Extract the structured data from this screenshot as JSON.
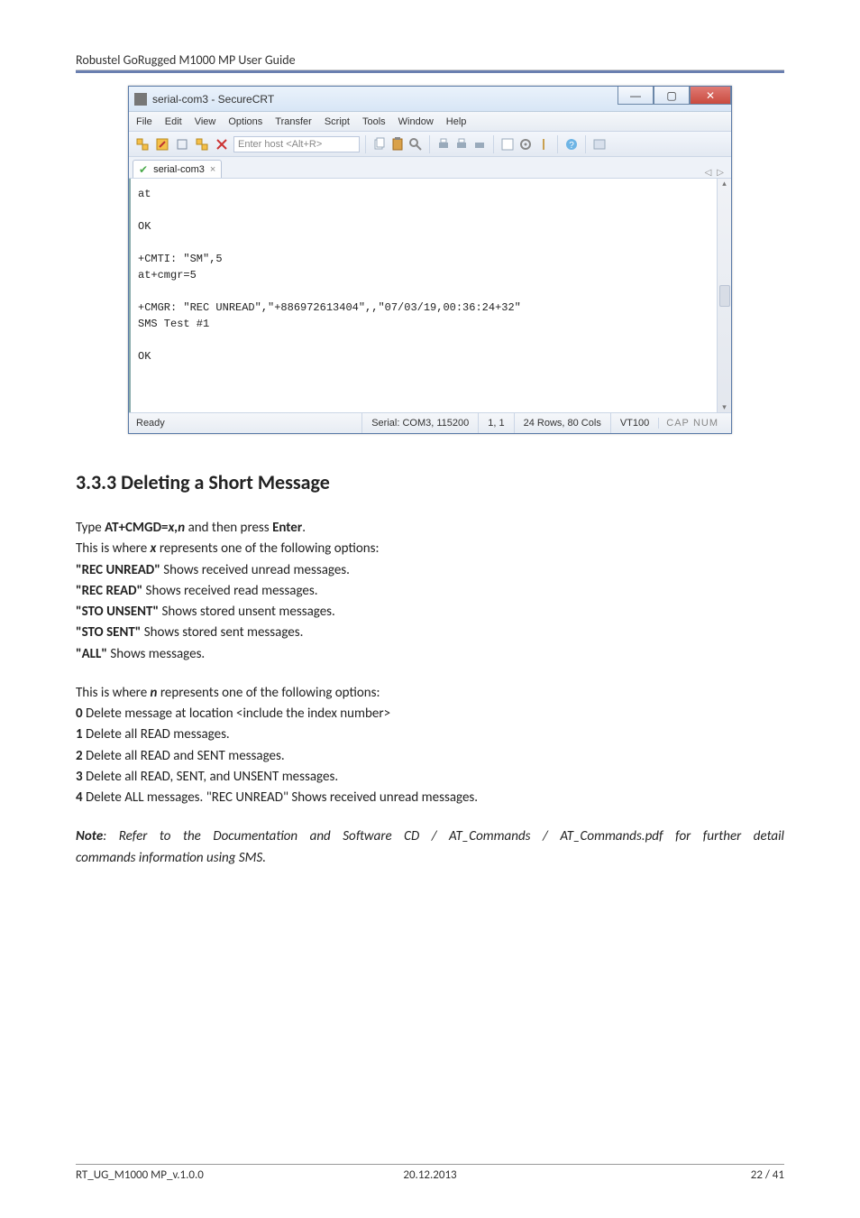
{
  "header": {
    "title": "Robustel GoRugged M1000 MP User Guide"
  },
  "app": {
    "title": "serial-com3 - SecureCRT",
    "menus": [
      "File",
      "Edit",
      "View",
      "Options",
      "Transfer",
      "Script",
      "Tools",
      "Window",
      "Help"
    ],
    "host_placeholder": "Enter host <Alt+R>",
    "tab": {
      "label": "serial-com3",
      "close": "×"
    },
    "terminal_text": "at\n\nOK\n\n+CMTI: \"SM\",5\nat+cmgr=5\n\n+CMGR: \"REC UNREAD\",\"+886972613404\",,\"07/03/19,00:36:24+32\"\nSMS Test #1\n\nOK",
    "status": {
      "ready": "Ready",
      "serial": "Serial: COM3, 115200",
      "pos": "1,   1",
      "size": "24 Rows, 80 Cols",
      "emu": "VT100",
      "caps": "CAP",
      "num": "NUM"
    }
  },
  "section": {
    "heading": "3.3.3  Deleting a Short Message",
    "intro_prefix": "Type ",
    "intro_cmd": "AT+CMGD=",
    "intro_args": "x,n",
    "intro_mid": " and then press ",
    "intro_enter": "Enter",
    "intro_suffix": ".",
    "x_line_prefix": "This is where ",
    "x_var": "x",
    "x_line_suffix": " represents one of the following options:",
    "x_opts": [
      {
        "k": "\"REC UNREAD\"",
        "v": " Shows received unread messages."
      },
      {
        "k": "\"REC READ\"",
        "v": " Shows received read messages."
      },
      {
        "k": "\"STO UNSENT\"",
        "v": " Shows stored unsent messages."
      },
      {
        "k": "\"STO SENT\"",
        "v": " Shows stored sent messages."
      },
      {
        "k": "\"ALL\"",
        "v": " Shows messages."
      }
    ],
    "n_line_prefix": "This is where ",
    "n_var": "n",
    "n_line_suffix": " represents one of the following options:",
    "n_opts": [
      {
        "k": "0",
        "v": " Delete message at location <include the index number>"
      },
      {
        "k": "1",
        "v": " Delete all READ messages."
      },
      {
        "k": "2",
        "v": " Delete all READ and SENT messages."
      },
      {
        "k": "3",
        "v": " Delete all READ, SENT, and UNSENT messages."
      },
      {
        "k": "4",
        "v": " Delete ALL messages. \"REC UNREAD\" Shows received unread messages."
      }
    ],
    "note_label": "Note",
    "note_line1": ": Refer to the Documentation and Software CD / AT_Commands / AT_Commands.pdf for further detail",
    "note_line2": "commands information using SMS."
  },
  "footer": {
    "left": "RT_UG_M1000 MP_v.1.0.0",
    "center": "20.12.2013",
    "right": "22 / 41"
  }
}
